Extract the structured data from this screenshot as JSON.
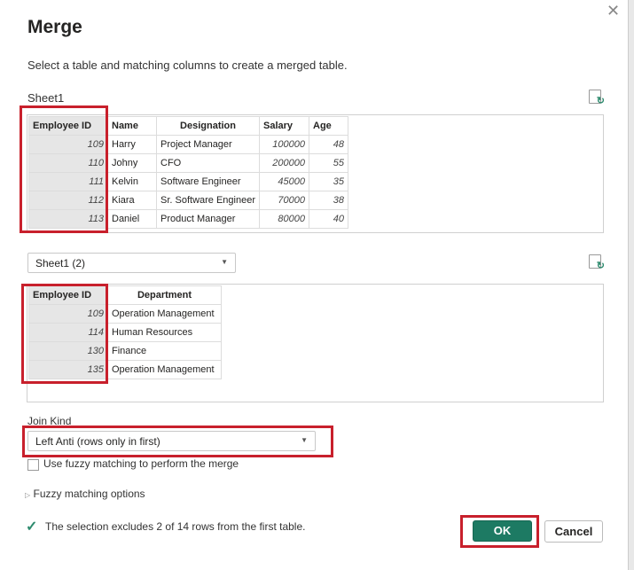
{
  "dialog": {
    "title": "Merge",
    "subtitle": "Select a table and matching columns to create a merged table.",
    "close": "✕"
  },
  "table1": {
    "label": "Sheet1",
    "columns": [
      "Employee ID",
      "Name",
      "Designation",
      "Salary",
      "Age"
    ],
    "rows": [
      [
        "109",
        "Harry",
        "Project Manager",
        "100000",
        "48"
      ],
      [
        "110",
        "Johny",
        "CFO",
        "200000",
        "55"
      ],
      [
        "111",
        "Kelvin",
        "Software Engineer",
        "45000",
        "35"
      ],
      [
        "112",
        "Kiara",
        "Sr. Software Engineer",
        "70000",
        "38"
      ],
      [
        "113",
        "Daniel",
        "Product Manager",
        "80000",
        "40"
      ]
    ]
  },
  "table2": {
    "selected": "Sheet1 (2)",
    "columns": [
      "Employee ID",
      "Department"
    ],
    "rows": [
      [
        "109",
        "Operation Management"
      ],
      [
        "114",
        "Human Resources"
      ],
      [
        "130",
        "Finance"
      ],
      [
        "135",
        "Operation Management"
      ]
    ]
  },
  "join": {
    "label": "Join Kind",
    "value": "Left Anti (rows only in first)"
  },
  "fuzzy": {
    "checkbox_label": "Use fuzzy matching to perform the merge",
    "checked": false,
    "options_label": "Fuzzy matching options"
  },
  "status": {
    "text": "The selection excludes 2 of 14 rows from the first table."
  },
  "buttons": {
    "ok": "OK",
    "cancel": "Cancel"
  },
  "colors": {
    "accent": "#1d7a63",
    "highlight": "#c8202c"
  }
}
